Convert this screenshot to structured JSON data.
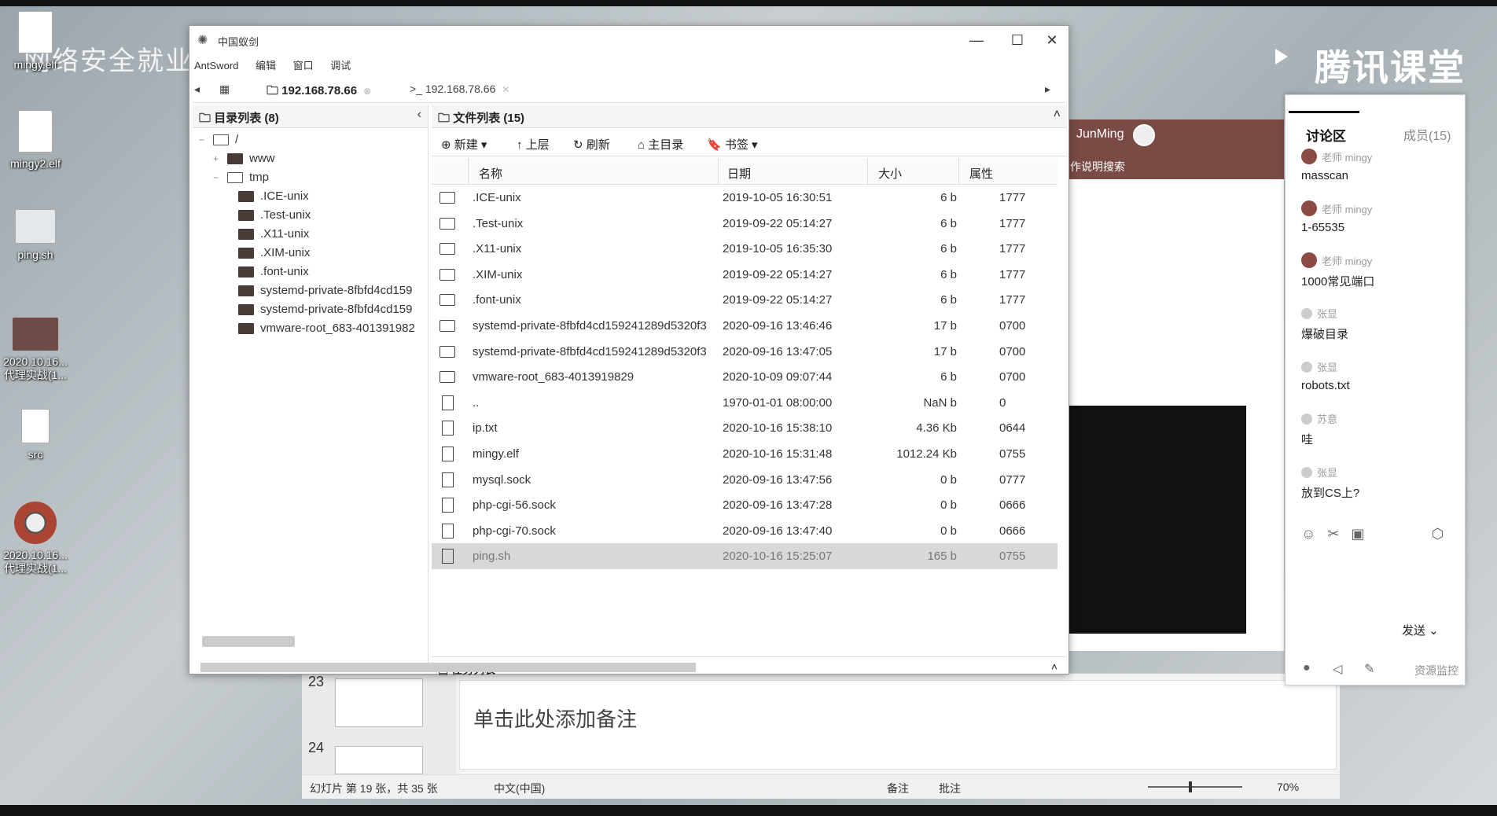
{
  "desktop": {
    "watermark_left": "网络安全就业",
    "watermark_right": "腾讯课堂",
    "icons": [
      {
        "label": "mingy.elf"
      },
      {
        "label": "mingy2.elf"
      },
      {
        "label": "ping.sh"
      },
      {
        "label": "2020.10.16...\n代理实战(1..."
      },
      {
        "label": "src"
      },
      {
        "label": "2020.10.16...\n代理实战(1..."
      }
    ]
  },
  "window": {
    "title": "中国蚁剑",
    "menu": [
      "AntSword",
      "编辑",
      "窗口",
      "调试"
    ],
    "tabs": [
      {
        "label": "192.168.78.66",
        "active": true
      },
      {
        "label": ">_ 192.168.78.66",
        "active": false
      }
    ],
    "dir_panel": {
      "title": "目录列表 (8)",
      "root": "/",
      "nodes": [
        "www",
        "tmp",
        ".ICE-unix",
        ".Test-unix",
        ".X11-unix",
        ".XIM-unix",
        ".font-unix",
        "systemd-private-8fbfd4cd159",
        "systemd-private-8fbfd4cd159",
        "vmware-root_683-401391982"
      ]
    },
    "file_panel": {
      "title": "文件列表 (15)",
      "toolbar": {
        "new": "新建",
        "up": "上层",
        "refresh": "刷新",
        "home": "主目录",
        "bookmark": "书签"
      },
      "headers": {
        "name": "名称",
        "date": "日期",
        "size": "大小",
        "attr": "属性"
      },
      "rows": [
        {
          "type": "folder",
          "name": ".ICE-unix",
          "date": "2019-10-05 16:30:51",
          "size": "6 b",
          "attr": "1777"
        },
        {
          "type": "folder",
          "name": ".Test-unix",
          "date": "2019-09-22 05:14:27",
          "size": "6 b",
          "attr": "1777"
        },
        {
          "type": "folder",
          "name": ".X11-unix",
          "date": "2019-10-05 16:35:30",
          "size": "6 b",
          "attr": "1777"
        },
        {
          "type": "folder",
          "name": ".XIM-unix",
          "date": "2019-09-22 05:14:27",
          "size": "6 b",
          "attr": "1777"
        },
        {
          "type": "folder",
          "name": ".font-unix",
          "date": "2019-09-22 05:14:27",
          "size": "6 b",
          "attr": "1777"
        },
        {
          "type": "folder",
          "name": "systemd-private-8fbfd4cd159241289d5320f3",
          "date": "2020-09-16 13:46:46",
          "size": "17 b",
          "attr": "0700"
        },
        {
          "type": "folder",
          "name": "systemd-private-8fbfd4cd159241289d5320f3",
          "date": "2020-09-16 13:47:05",
          "size": "17 b",
          "attr": "0700"
        },
        {
          "type": "folder",
          "name": "vmware-root_683-4013919829",
          "date": "2020-10-09 09:07:44",
          "size": "6 b",
          "attr": "0700"
        },
        {
          "type": "file",
          "name": "..",
          "date": "1970-01-01 08:00:00",
          "size": "NaN b",
          "attr": "0"
        },
        {
          "type": "file",
          "name": "ip.txt",
          "date": "2020-10-16 15:38:10",
          "size": "4.36 Kb",
          "attr": "0644"
        },
        {
          "type": "file",
          "name": "mingy.elf",
          "date": "2020-10-16 15:31:48",
          "size": "1012.24 Kb",
          "attr": "0755"
        },
        {
          "type": "file",
          "name": "mysql.sock",
          "date": "2020-09-16 13:47:56",
          "size": "0 b",
          "attr": "0777"
        },
        {
          "type": "file",
          "name": "php-cgi-56.sock",
          "date": "2020-09-16 13:47:28",
          "size": "0 b",
          "attr": "0666"
        },
        {
          "type": "file",
          "name": "php-cgi-70.sock",
          "date": "2020-09-16 13:47:40",
          "size": "0 b",
          "attr": "0666"
        },
        {
          "type": "file",
          "name": "ping.sh",
          "date": "2020-10-16 15:25:07",
          "size": "165 b",
          "attr": "0755",
          "selected": true
        }
      ]
    },
    "task_panel": {
      "title": "任务列表"
    }
  },
  "slides_app": {
    "thumb_numbers": [
      "23",
      "24"
    ],
    "notes_placeholder": "单击此处添加备注",
    "status": {
      "slide": "幻灯片 第 19 张，共 35 张",
      "language": "中文(中国)",
      "notes": "备注",
      "comments": "批注",
      "zoom": "70%"
    }
  },
  "background_page": {
    "user": "JunMing",
    "subtitle": "作说明搜索"
  },
  "chat": {
    "tabs": {
      "discussion": "讨论区",
      "members": "成员(15)"
    },
    "messages": [
      {
        "who": "老师 mingy",
        "body": "masscan",
        "teacher": true
      },
      {
        "who": "老师 mingy",
        "body": "1-65535",
        "teacher": true
      },
      {
        "who": "老师 mingy",
        "body": "1000常见端口",
        "teacher": true
      },
      {
        "who": "张显",
        "body": "爆破目录",
        "teacher": false
      },
      {
        "who": "张显",
        "body": "robots.txt",
        "teacher": false
      },
      {
        "who": "苏意",
        "body": "哇",
        "teacher": false
      },
      {
        "who": "张显",
        "body": "放到CS上?",
        "teacher": false
      }
    ],
    "send_label": "发送",
    "resource_label": "资源监控"
  }
}
